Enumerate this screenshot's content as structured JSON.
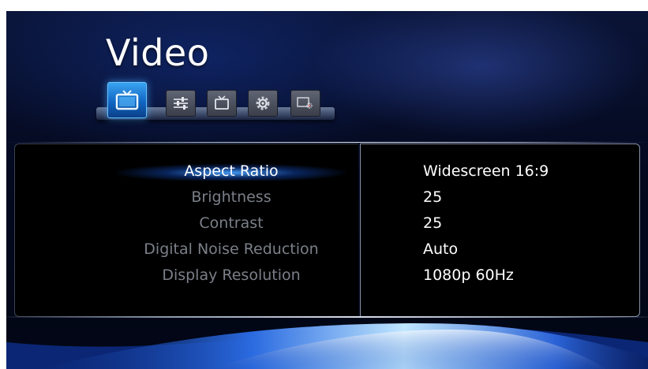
{
  "title": "Video",
  "tabs": [
    {
      "icon": "tv-icon",
      "active": true
    },
    {
      "icon": "sliders-icon",
      "active": false
    },
    {
      "icon": "tv-outline-icon",
      "active": false
    },
    {
      "icon": "gear-icon",
      "active": false
    },
    {
      "icon": "screen-sparkle-icon",
      "active": false
    }
  ],
  "settings": [
    {
      "label": "Aspect Ratio",
      "value": "Widescreen 16:9"
    },
    {
      "label": "Brightness",
      "value": "25"
    },
    {
      "label": "Contrast",
      "value": "25"
    },
    {
      "label": "Digital Noise Reduction",
      "value": "Auto"
    },
    {
      "label": "Display Resolution",
      "value": "1080p 60Hz"
    }
  ],
  "selected_index": 0,
  "colors": {
    "accent": "#2a8ee6",
    "label_dim": "#7b7f88",
    "text": "#ffffff",
    "background": "#04091f"
  }
}
